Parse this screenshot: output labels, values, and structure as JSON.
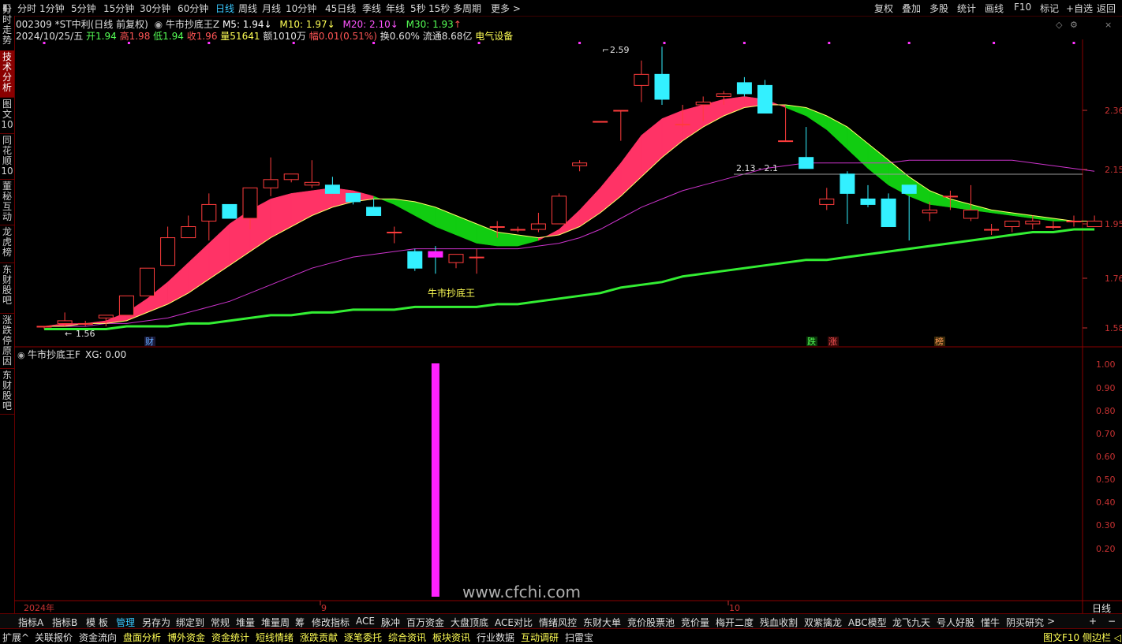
{
  "topbar": {
    "tabs": [
      "分时",
      "1分钟",
      "5分钟",
      "15分钟",
      "30分钟",
      "60分钟",
      "日线",
      "周线",
      "月线",
      "10分钟",
      "45日线",
      "季线",
      "年线",
      "5秒",
      "15秒",
      "多周期",
      "更多 >"
    ],
    "active": "日线",
    "right_buttons": [
      "复权",
      "叠加",
      "多股",
      "统计",
      "画线",
      "F10",
      "标记",
      "+自选",
      "返回"
    ]
  },
  "sidebar": {
    "tabs": [
      "分时走势",
      "技术分析",
      "图文10",
      "同花顺10",
      "董秘互动",
      "龙虎榜",
      "东财股吧",
      "涨跌停原因",
      "东财股吧"
    ],
    "active": "技术分析"
  },
  "header": {
    "code_name": "002309 *ST中利(日线 前复权)",
    "indicator_name": "牛市抄底王Z",
    "m5": "M5: 1.94",
    "m10": "M10: 1.97",
    "m20": "M20: 2.10",
    "m30": "M30: 1.93",
    "date": "2024/10/25/五",
    "open": "开1.94",
    "high": "高1.98",
    "low": "低1.94",
    "close": "收1.96",
    "volume": "量51641",
    "amount": "额1010万",
    "change": "幅0.01(0.51%)",
    "turnover": "换0.60%",
    "float_cap": "流通8.68亿",
    "sector": "电气设备"
  },
  "main_chart": {
    "annotations": {
      "high_label": "2.59",
      "low_label": "1.56",
      "range_label": "2.13 - 2.1",
      "signal_text": "牛市抄底王",
      "event_cai": "财",
      "event_die": "跌",
      "event_zhang": "涨",
      "event_bang": "榜"
    },
    "y_ticks": [
      "2.36",
      "2.15",
      "1.95",
      "1.76",
      "1.58"
    ],
    "x_labels": [
      "2024年",
      "9",
      "10"
    ]
  },
  "sub_chart": {
    "title": "牛市抄底王F",
    "value": "XG: 0.00",
    "y_ticks": [
      "1.00",
      "0.90",
      "0.80",
      "0.70",
      "0.60",
      "0.50",
      "0.40",
      "0.30",
      "0.20"
    ],
    "watermark": "www.cfchi.com"
  },
  "period_label": "日线",
  "bottom_tabs1": [
    "指标A",
    "指标B",
    "模 板",
    "管理",
    "另存为",
    "绑定到",
    "常规",
    "堆量",
    "堆量周",
    "筹",
    "修改指标",
    "ACE",
    "脉冲",
    "百万资金",
    "大盘顶底",
    "ACE对比",
    "情绪风控",
    "东财大单",
    "竞价股票池",
    "竞价量",
    "梅开二度",
    "残血收割",
    "双紫擒龙",
    "ABC模型",
    "龙飞九天",
    "号人好股",
    "懂牛",
    "阴买研究",
    ">"
  ],
  "bottom_tabs2": [
    "扩展^",
    "关联报价",
    "资金流向",
    "盘面分析",
    "博外资金",
    "资金统计",
    "短线情绪",
    "涨跌贡献",
    "逐笔委托",
    "综合资讯",
    "板块资讯",
    "行业数据",
    "互动调研",
    "扫雷宝"
  ],
  "bottom_right": "图文F10 侧边栏 ◁",
  "zoom_buttons": [
    "+",
    "−"
  ],
  "chart_data": {
    "type": "candlestick",
    "y_range": [
      1.5,
      2.7
    ],
    "candles": [
      [
        1.58,
        1.58,
        1.57,
        1.58
      ],
      [
        1.59,
        1.63,
        1.58,
        1.6
      ],
      [
        1.59,
        1.6,
        1.58,
        1.59
      ],
      [
        1.61,
        1.62,
        1.58,
        1.62
      ],
      [
        1.62,
        1.69,
        1.62,
        1.69
      ],
      [
        1.69,
        1.79,
        1.69,
        1.79
      ],
      [
        1.8,
        1.94,
        1.8,
        1.9
      ],
      [
        1.9,
        1.98,
        1.9,
        1.94
      ],
      [
        1.96,
        2.06,
        1.89,
        2.02
      ],
      [
        2.02,
        2.0,
        1.97,
        1.97
      ],
      [
        1.97,
        2.07,
        1.93,
        2.08
      ],
      [
        2.08,
        2.19,
        2.05,
        2.11
      ],
      [
        2.11,
        2.13,
        2.1,
        2.13
      ],
      [
        2.09,
        2.18,
        2.08,
        2.1
      ],
      [
        2.09,
        2.12,
        2.06,
        2.06
      ],
      [
        2.06,
        2.06,
        2.02,
        2.03
      ],
      [
        2.01,
        2.04,
        1.99,
        1.98
      ],
      [
        1.92,
        1.94,
        1.88,
        1.92
      ],
      [
        1.85,
        1.86,
        1.78,
        1.79
      ],
      [
        1.85,
        1.87,
        1.77,
        1.83
      ],
      [
        1.81,
        1.84,
        1.79,
        1.84
      ],
      [
        1.83,
        1.86,
        1.77,
        1.83
      ],
      [
        1.94,
        1.96,
        1.9,
        1.94
      ],
      [
        1.93,
        1.94,
        1.92,
        1.93
      ],
      [
        1.93,
        1.99,
        1.92,
        1.95
      ],
      [
        1.95,
        2.06,
        1.95,
        2.05
      ],
      [
        2.16,
        2.18,
        2.14,
        2.17
      ],
      [
        2.32,
        2.32,
        2.32,
        2.32
      ],
      [
        2.36,
        2.36,
        2.25,
        2.36
      ],
      [
        2.45,
        2.54,
        2.39,
        2.49
      ],
      [
        2.49,
        2.59,
        2.38,
        2.4
      ],
      [
        2.31,
        2.38,
        2.3,
        2.31
      ],
      [
        2.38,
        2.41,
        2.32,
        2.39
      ],
      [
        2.41,
        2.43,
        2.38,
        2.42
      ],
      [
        2.46,
        2.48,
        2.41,
        2.42
      ],
      [
        2.45,
        2.47,
        2.38,
        2.35
      ],
      [
        2.25,
        2.37,
        2.25,
        2.25
      ],
      [
        2.19,
        2.3,
        2.15,
        2.15
      ],
      [
        2.02,
        2.08,
        2.0,
        2.04
      ],
      [
        2.13,
        2.14,
        1.95,
        2.06
      ],
      [
        2.04,
        2.09,
        2.01,
        2.02
      ],
      [
        2.04,
        2.06,
        1.94,
        1.94
      ],
      [
        2.09,
        2.05,
        1.89,
        2.06
      ],
      [
        1.99,
        2.03,
        1.96,
        2.0
      ],
      [
        2.05,
        2.07,
        2.0,
        2.05
      ],
      [
        1.97,
        2.09,
        1.96,
        2.0
      ],
      [
        1.93,
        1.95,
        1.91,
        1.93
      ],
      [
        1.94,
        1.96,
        1.92,
        1.96
      ],
      [
        1.95,
        1.98,
        1.93,
        1.96
      ],
      [
        1.94,
        1.96,
        1.93,
        1.94
      ],
      [
        1.96,
        1.98,
        1.94,
        1.96
      ],
      [
        1.94,
        1.98,
        1.94,
        1.96
      ]
    ],
    "ma_fast": [
      1.58,
      1.59,
      1.59,
      1.6,
      1.63,
      1.68,
      1.74,
      1.81,
      1.88,
      1.95,
      2.0,
      2.04,
      2.06,
      2.07,
      2.08,
      2.07,
      2.05,
      2.02,
      1.98,
      1.94,
      1.91,
      1.88,
      1.87,
      1.87,
      1.89,
      1.93,
      2.0,
      2.08,
      2.17,
      2.27,
      2.33,
      2.36,
      2.38,
      2.4,
      2.41,
      2.4,
      2.37,
      2.34,
      2.29,
      2.22,
      2.15,
      2.09,
      2.05,
      2.02,
      2.01,
      2.0,
      1.99,
      1.98,
      1.97,
      1.96,
      1.96,
      1.96
    ],
    "ma_slow": [
      1.58,
      1.58,
      1.59,
      1.59,
      1.6,
      1.63,
      1.66,
      1.7,
      1.75,
      1.8,
      1.85,
      1.9,
      1.94,
      1.98,
      2.01,
      2.03,
      2.04,
      2.04,
      2.03,
      2.01,
      1.98,
      1.95,
      1.92,
      1.91,
      1.9,
      1.91,
      1.94,
      1.99,
      2.05,
      2.12,
      2.19,
      2.25,
      2.3,
      2.34,
      2.37,
      2.38,
      2.38,
      2.37,
      2.34,
      2.3,
      2.24,
      2.18,
      2.12,
      2.07,
      2.04,
      2.02,
      2.0,
      1.99,
      1.98,
      1.97,
      1.96,
      1.96
    ],
    "ma_purple": [
      1.58,
      1.58,
      1.58,
      1.59,
      1.59,
      1.6,
      1.61,
      1.63,
      1.65,
      1.67,
      1.7,
      1.73,
      1.76,
      1.79,
      1.81,
      1.83,
      1.84,
      1.85,
      1.86,
      1.86,
      1.86,
      1.86,
      1.86,
      1.86,
      1.87,
      1.88,
      1.9,
      1.93,
      1.97,
      2.01,
      2.04,
      2.07,
      2.09,
      2.11,
      2.13,
      2.15,
      2.16,
      2.17,
      2.17,
      2.17,
      2.17,
      2.17,
      2.18,
      2.18,
      2.18,
      2.18,
      2.18,
      2.18,
      2.17,
      2.16,
      2.15,
      2.14
    ],
    "ma_green": [
      1.57,
      1.57,
      1.57,
      1.57,
      1.58,
      1.58,
      1.58,
      1.59,
      1.59,
      1.6,
      1.61,
      1.62,
      1.62,
      1.63,
      1.63,
      1.64,
      1.64,
      1.64,
      1.65,
      1.65,
      1.65,
      1.65,
      1.66,
      1.66,
      1.67,
      1.68,
      1.69,
      1.7,
      1.72,
      1.73,
      1.74,
      1.76,
      1.77,
      1.78,
      1.79,
      1.8,
      1.81,
      1.82,
      1.82,
      1.83,
      1.84,
      1.85,
      1.86,
      1.87,
      1.88,
      1.89,
      1.9,
      1.91,
      1.92,
      1.92,
      1.93,
      1.93
    ],
    "signal_bar": {
      "candle_index": 19,
      "value": 1.0
    }
  }
}
